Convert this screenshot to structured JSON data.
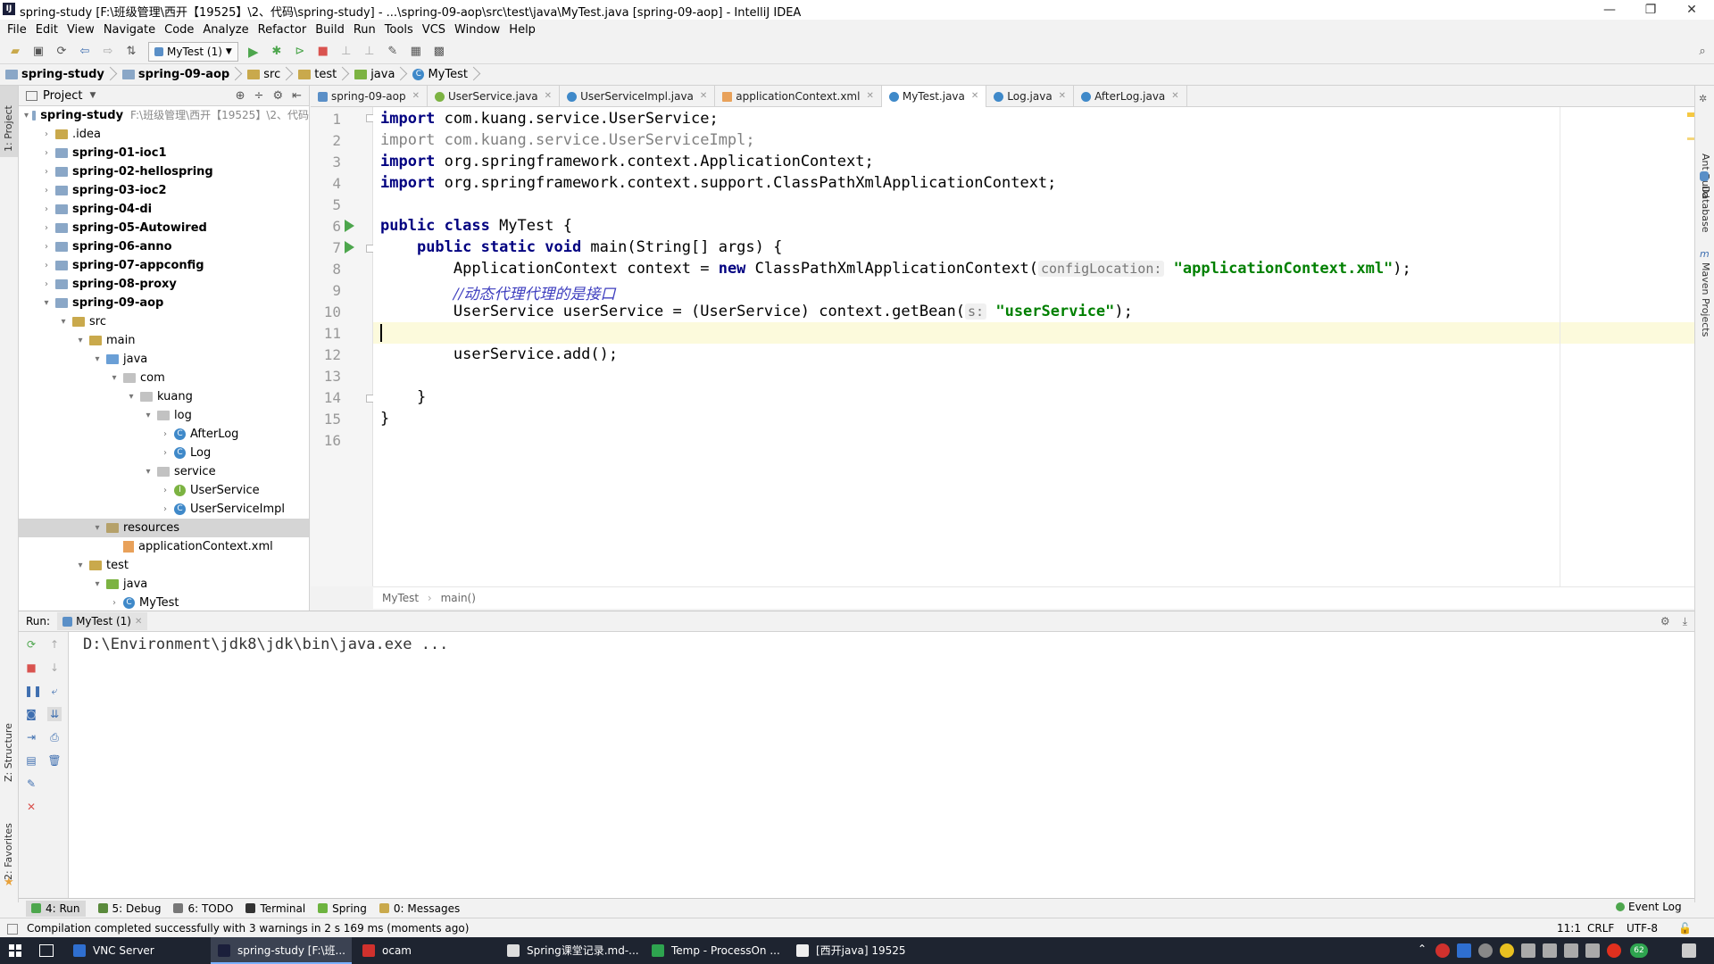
{
  "window": {
    "title": "spring-study [F:\\班级管理\\西开【19525】\\2、代码\\spring-study] - ...\\spring-09-aop\\src\\test\\java\\MyTest.java [spring-09-aop] - IntelliJ IDEA",
    "minimize": "—",
    "restore": "❐",
    "close": "✕"
  },
  "menu": [
    "File",
    "Edit",
    "View",
    "Navigate",
    "Code",
    "Analyze",
    "Refactor",
    "Build",
    "Run",
    "Tools",
    "VCS",
    "Window",
    "Help"
  ],
  "toolbar": {
    "run_config": "MyTest (1)"
  },
  "breadcrumbs": [
    "spring-study",
    "spring-09-aop",
    "src",
    "test",
    "java",
    "MyTest"
  ],
  "left_stripe": {
    "project": "1: Project",
    "structure": "Z: Structure",
    "favorites": "2: Favorites"
  },
  "right_stripe": {
    "ant": "Ant Build",
    "database": "Database",
    "maven": "Maven Projects"
  },
  "project_panel": {
    "title": "Project",
    "root_name": "spring-study",
    "root_path": "F:\\班级管理\\西开【19525】\\2、代码"
  },
  "tree": [
    {
      "label": "spring-study",
      "depth": 0,
      "arrow": "▾",
      "type": "module",
      "bold": true
    },
    {
      "label": ".idea",
      "depth": 1,
      "arrow": "›",
      "type": "folder",
      "bold": false
    },
    {
      "label": "spring-01-ioc1",
      "depth": 1,
      "arrow": "›",
      "type": "module",
      "bold": true
    },
    {
      "label": "spring-02-hellospring",
      "depth": 1,
      "arrow": "›",
      "type": "module",
      "bold": true
    },
    {
      "label": "spring-03-ioc2",
      "depth": 1,
      "arrow": "›",
      "type": "module",
      "bold": true
    },
    {
      "label": "spring-04-di",
      "depth": 1,
      "arrow": "›",
      "type": "module",
      "bold": true
    },
    {
      "label": "spring-05-Autowired",
      "depth": 1,
      "arrow": "›",
      "type": "module",
      "bold": true
    },
    {
      "label": "spring-06-anno",
      "depth": 1,
      "arrow": "›",
      "type": "module",
      "bold": true
    },
    {
      "label": "spring-07-appconfig",
      "depth": 1,
      "arrow": "›",
      "type": "module",
      "bold": true
    },
    {
      "label": "spring-08-proxy",
      "depth": 1,
      "arrow": "›",
      "type": "module",
      "bold": true
    },
    {
      "label": "spring-09-aop",
      "depth": 1,
      "arrow": "▾",
      "type": "module",
      "bold": true
    },
    {
      "label": "src",
      "depth": 2,
      "arrow": "▾",
      "type": "folder",
      "bold": false
    },
    {
      "label": "main",
      "depth": 3,
      "arrow": "▾",
      "type": "folder",
      "bold": false
    },
    {
      "label": "java",
      "depth": 4,
      "arrow": "▾",
      "type": "srcfolder",
      "bold": false
    },
    {
      "label": "com",
      "depth": 5,
      "arrow": "▾",
      "type": "package",
      "bold": false
    },
    {
      "label": "kuang",
      "depth": 6,
      "arrow": "▾",
      "type": "package",
      "bold": false
    },
    {
      "label": "log",
      "depth": 7,
      "arrow": "▾",
      "type": "package",
      "bold": false
    },
    {
      "label": "AfterLog",
      "depth": 8,
      "arrow": "›",
      "type": "class",
      "bold": false
    },
    {
      "label": "Log",
      "depth": 8,
      "arrow": "›",
      "type": "class",
      "bold": false
    },
    {
      "label": "service",
      "depth": 7,
      "arrow": "▾",
      "type": "package",
      "bold": false
    },
    {
      "label": "UserService",
      "depth": 8,
      "arrow": "›",
      "type": "interface",
      "bold": false
    },
    {
      "label": "UserServiceImpl",
      "depth": 8,
      "arrow": "›",
      "type": "class",
      "bold": false
    },
    {
      "label": "resources",
      "depth": 4,
      "arrow": "▾",
      "type": "resfolder",
      "bold": false,
      "selected": true
    },
    {
      "label": "applicationContext.xml",
      "depth": 5,
      "arrow": "",
      "type": "xml",
      "bold": false
    },
    {
      "label": "test",
      "depth": 3,
      "arrow": "▾",
      "type": "folder",
      "bold": false
    },
    {
      "label": "java",
      "depth": 4,
      "arrow": "▾",
      "type": "testfolder",
      "bold": false
    },
    {
      "label": "MyTest",
      "depth": 5,
      "arrow": "›",
      "type": "class",
      "bold": false
    }
  ],
  "tabs": [
    {
      "label": "spring-09-aop",
      "icon": "m",
      "active": false
    },
    {
      "label": "UserService.java",
      "icon": "i",
      "active": false
    },
    {
      "label": "UserServiceImpl.java",
      "icon": "c",
      "active": false
    },
    {
      "label": "applicationContext.xml",
      "icon": "x",
      "active": false
    },
    {
      "label": "MyTest.java",
      "icon": "c",
      "active": true
    },
    {
      "label": "Log.java",
      "icon": "c",
      "active": false
    },
    {
      "label": "AfterLog.java",
      "icon": "c",
      "active": false
    }
  ],
  "code": {
    "line_numbers": [
      "1",
      "2",
      "3",
      "4",
      "5",
      "6",
      "7",
      "8",
      "9",
      "10",
      "11",
      "12",
      "13",
      "14",
      "15",
      "16"
    ],
    "l1_kw": "import",
    "l1_rest": " com.kuang.service.UserService;",
    "l2": "import com.kuang.service.UserServiceImpl;",
    "l3_kw": "import",
    "l3_rest": " org.springframework.context.ApplicationContext;",
    "l4_kw": "import",
    "l4_rest": " org.springframework.context.support.ClassPathXmlApplicationContext;",
    "l6_kw": "public class",
    "l6_rest": " MyTest {",
    "l7_indent": "    ",
    "l7_kw": "public static void",
    "l7_rest": " main(String[] args) {",
    "l8_a": "        ApplicationContext context = ",
    "l8_kw": "new",
    "l8_b": " ClassPathXmlApplicationContext(",
    "l8_hint": "configLocation:",
    "l8_str": "\"applicationContext.xml\"",
    "l8_c": ");",
    "l9_indent": "        ",
    "l9_cmt": "//动态代理代理的是接口",
    "l10_a": "        UserService userService = (UserService) context.getBean(",
    "l10_hint": "s:",
    "l10_str": "\"userService\"",
    "l10_c": ");",
    "l12": "        userService.add();",
    "l14": "    }",
    "l15": "}"
  },
  "editor_breadcrumb": [
    "MyTest",
    "main()"
  ],
  "run_panel": {
    "label": "Run:",
    "config": "MyTest (1)",
    "output": "D:\\Environment\\jdk8\\jdk\\bin\\java.exe ..."
  },
  "tool_windows": [
    {
      "label": "4: Run",
      "color": "#4da64d"
    },
    {
      "label": "5: Debug",
      "color": "#5a8a3c"
    },
    {
      "label": "6: TODO",
      "color": "#777777"
    },
    {
      "label": "Terminal",
      "color": "#333333"
    },
    {
      "label": "Spring",
      "color": "#6db33f"
    },
    {
      "label": "0: Messages",
      "color": "#c9a94c"
    }
  ],
  "event_log": "Event Log",
  "status": {
    "message": "Compilation completed successfully with 3 warnings in 2 s 169 ms (moments ago)",
    "position": "11:1",
    "line_sep": "CRLF",
    "encoding": "UTF-8"
  },
  "taskbar": [
    {
      "label": "VNC Server",
      "color": "#2f6fd0",
      "active": false
    },
    {
      "label": "spring-study [F:\\班...",
      "color": "#1b1f3b",
      "active": true
    },
    {
      "label": "ocam",
      "color": "#d0312d",
      "active": false
    },
    {
      "label": "Spring课堂记录.md-...",
      "color": "#dddddd",
      "active": false
    },
    {
      "label": "Temp - ProcessOn ...",
      "color": "#2ea44f",
      "active": false
    },
    {
      "label": "[西开java] 19525",
      "color": "#eeeeee",
      "active": false
    }
  ],
  "tray_badge": "62"
}
